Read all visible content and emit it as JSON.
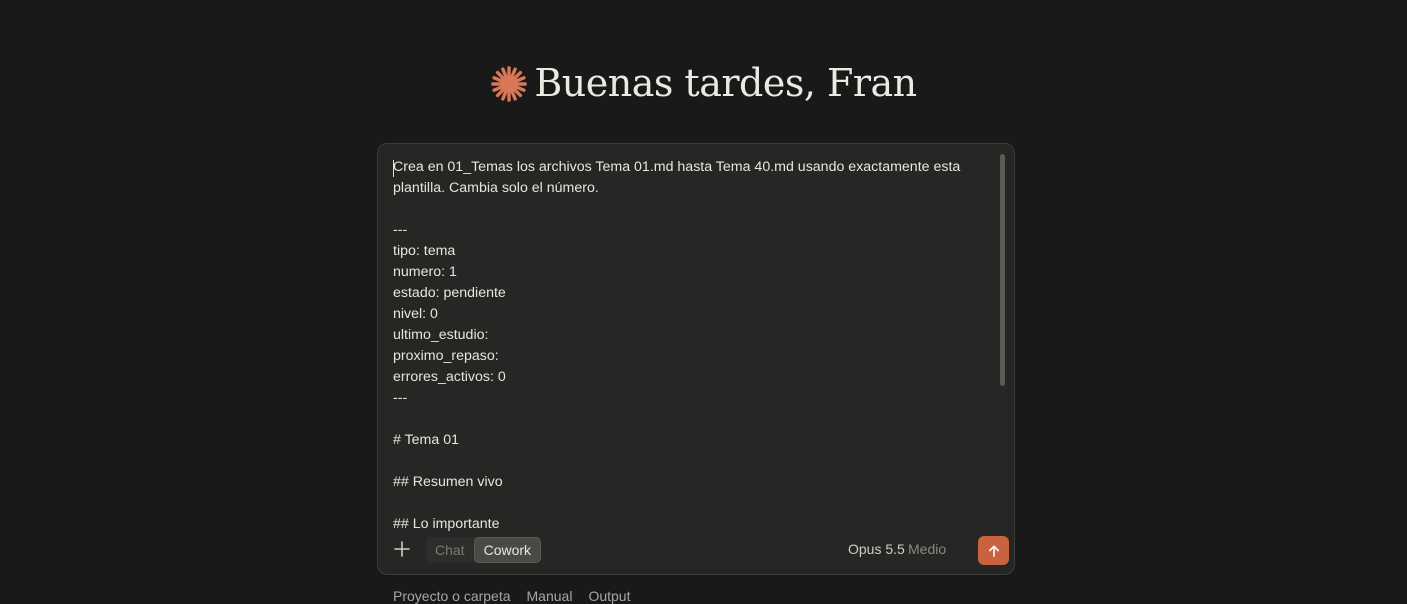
{
  "greeting": {
    "text": "Buenas tardes, Fran",
    "logo_icon": "sparkle-icon",
    "logo_color": "#d97757"
  },
  "composer": {
    "prompt_text": "Crea en 01_Temas los archivos Tema 01.md hasta Tema 40.md usando exactamente esta plantilla. Cambia solo el número.\n\n---\ntipo: tema\nnumero: 1\nestado: pendiente\nnivel: 0\nultimo_estudio:\nproximo_repaso:\nerrores_activos: 0\n---\n\n# Tema 01\n\n## Resumen vivo\n\n## Lo importante",
    "add_icon": "plus-icon",
    "modes": [
      "Chat",
      "Cowork"
    ],
    "active_mode": "Cowork",
    "model_label": "Opus 5.5",
    "effort_label": "Medio",
    "send_icon": "arrow-up-icon",
    "send_color": "#c9633f"
  },
  "bottom_links": [
    "Proyecto o carpeta",
    "Manual",
    "Output"
  ]
}
